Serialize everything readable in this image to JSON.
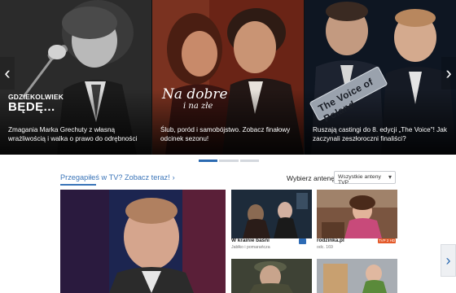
{
  "carousel": {
    "slides": [
      {
        "logo_line1": "GDZIEKOLWIEK",
        "logo_line2": "BĘDĘ...",
        "description": "Zmagania Marka Grechuty z własną wrażliwością i walka o prawo do odrębności"
      },
      {
        "logo_line1": "Na dobre",
        "logo_line2": "i na złe",
        "description": "Ślub, poród i samobójstwo. Zobacz finałowy odcinek sezonu!"
      },
      {
        "logo_text": "The Voice of Poland",
        "description": "Ruszają castingi do 8. edycji „The Voice\"! Jak zaczynali zeszłoroczni finaliści?"
      }
    ],
    "prev_icon": "‹",
    "next_icon": "›",
    "active_dot": 0
  },
  "section": {
    "title": "Przegapiłeś w TV? Zobacz teraz!",
    "chevron": "›",
    "antenna_label": "Wybierz antenę:",
    "antenna_value": "Wszystkie anteny TVP",
    "caret": "▾"
  },
  "tiles": [
    {
      "title": "W krainie baśni",
      "subtitle": "Jabłko i pomarańcza"
    },
    {
      "title": "rodzinka.pl",
      "subtitle": "odc. 169",
      "badge": "TVP 2 HD"
    }
  ],
  "side_arrow": "›",
  "colors": {
    "accent": "#2b6ab1",
    "link": "#3a74b8"
  }
}
